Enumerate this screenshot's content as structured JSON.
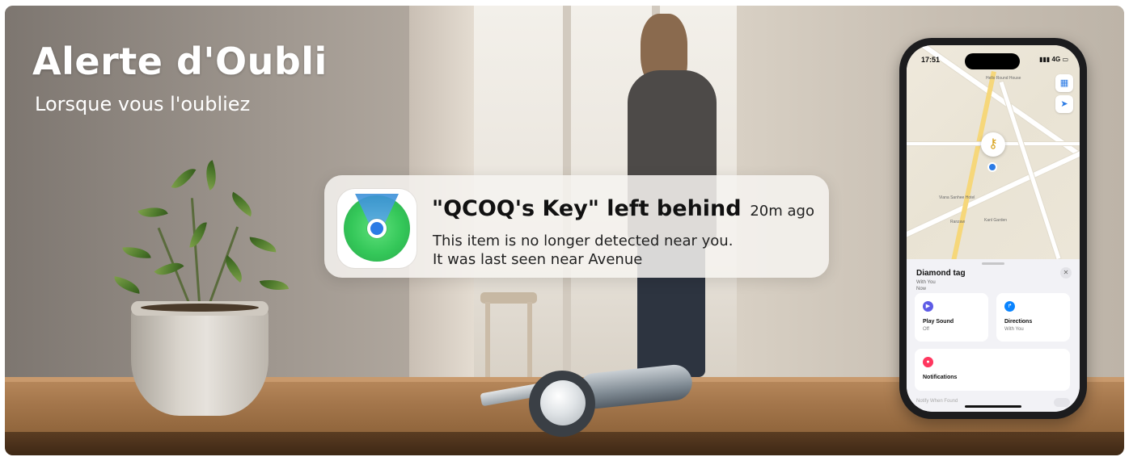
{
  "headline": {
    "title": "Alerte d'Oubli",
    "subtitle": "Lorsque vous l'oubliez"
  },
  "notification": {
    "app_icon": "find-my-icon",
    "title": "\"QCOQ's Key\" left behind",
    "time": "20m ago",
    "body_line1": "This item is no longer detected near you.",
    "body_line2": "It was last seen near Avenue"
  },
  "phone": {
    "status_time": "17:51",
    "status_network": "4G",
    "map_labels": [
      "Hello Round House",
      "Viana Sanhee Hotel",
      "Ranzaw",
      "Kanl Garden"
    ],
    "item": {
      "name": "Diamond tag",
      "with": "With You",
      "time": "Now"
    },
    "actions": [
      {
        "label": "Play Sound",
        "sub": "Off",
        "icon": "play-icon",
        "color": "#5e5ce6"
      },
      {
        "label": "Directions",
        "sub": "With You",
        "icon": "directions-icon",
        "color": "#0a84ff"
      },
      {
        "label": "Notifications",
        "sub": "",
        "icon": "bell-icon",
        "color": "#ff375f"
      }
    ],
    "notify_row": "Notify When Found"
  },
  "colors": {
    "notif_bg": "#f6f3f0",
    "find_my_green": "#34c759",
    "find_my_blue": "#2c7be5"
  }
}
